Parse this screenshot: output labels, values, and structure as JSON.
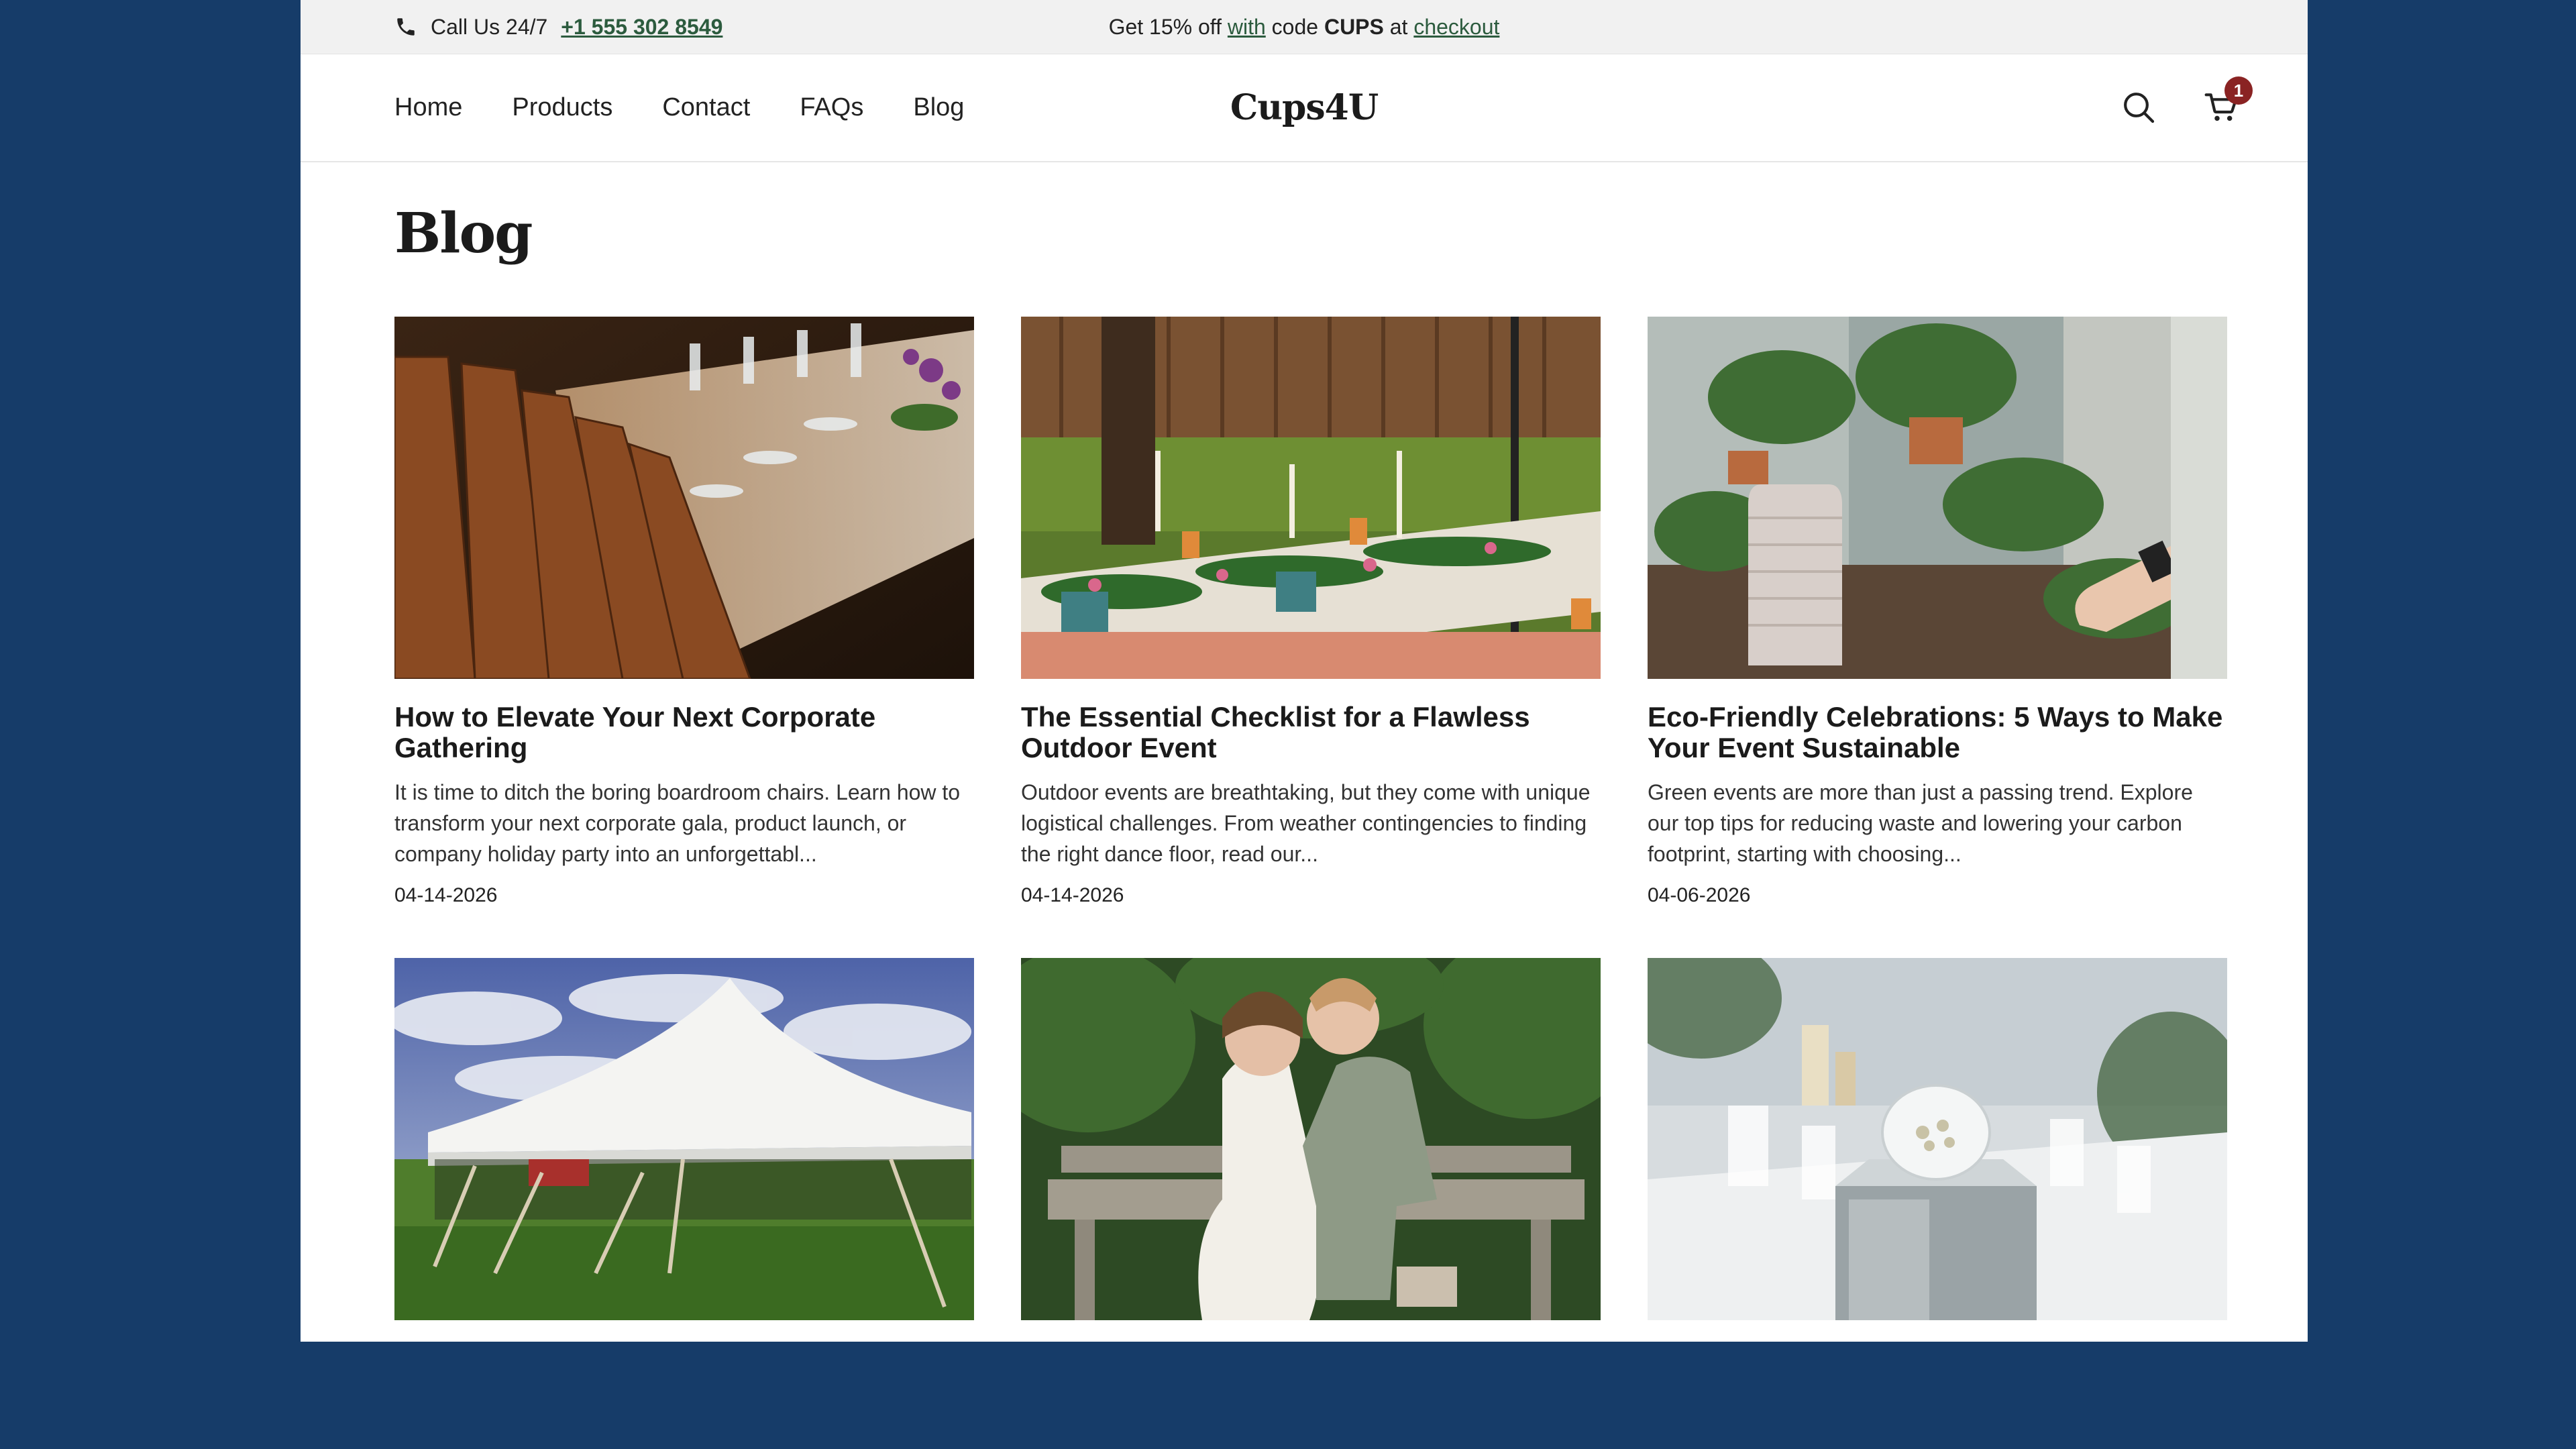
{
  "topbar": {
    "call_label": "Call Us 24/7",
    "phone": "+1 555 302 8549",
    "promo_parts": [
      "Get 15% off ",
      "with",
      " code ",
      "CUPS",
      " at ",
      "checkout"
    ]
  },
  "nav": {
    "items": [
      {
        "label": "Home"
      },
      {
        "label": "Products"
      },
      {
        "label": "Contact"
      },
      {
        "label": "FAQs"
      },
      {
        "label": "Blog"
      }
    ]
  },
  "brand": {
    "logo": "Cups4U"
  },
  "cart": {
    "count": "1"
  },
  "icons": {
    "search": "search-icon",
    "cart": "cart-icon",
    "phone": "phone-icon"
  },
  "colors": {
    "background": "#163c69",
    "accent_link": "#2c5b3e",
    "badge": "#8a2323"
  },
  "page": {
    "title": "Blog"
  },
  "posts": [
    {
      "title": "How to Elevate Your Next Corporate Gathering",
      "excerpt": "It is time to ditch the boring boardroom chairs. Learn how to transform your next corporate gala, product launch, or company holiday party into an unforgettabl...",
      "date": "04-14-2026"
    },
    {
      "title": "The Essential Checklist for a Flawless Outdoor Event",
      "excerpt": "Outdoor events are breathtaking, but they come with unique logistical challenges. From weather contingencies to finding the right dance floor, read our...",
      "date": "04-14-2026"
    },
    {
      "title": "Eco-Friendly Celebrations: 5 Ways to Make Your Event Sustainable",
      "excerpt": "Green events are more than just a passing trend. Explore our top tips for reducing waste and lowering your carbon footprint, starting with choosing...",
      "date": "04-06-2026"
    },
    {
      "title": "",
      "excerpt": "",
      "date": ""
    },
    {
      "title": "",
      "excerpt": "",
      "date": ""
    },
    {
      "title": "",
      "excerpt": "",
      "date": ""
    }
  ]
}
